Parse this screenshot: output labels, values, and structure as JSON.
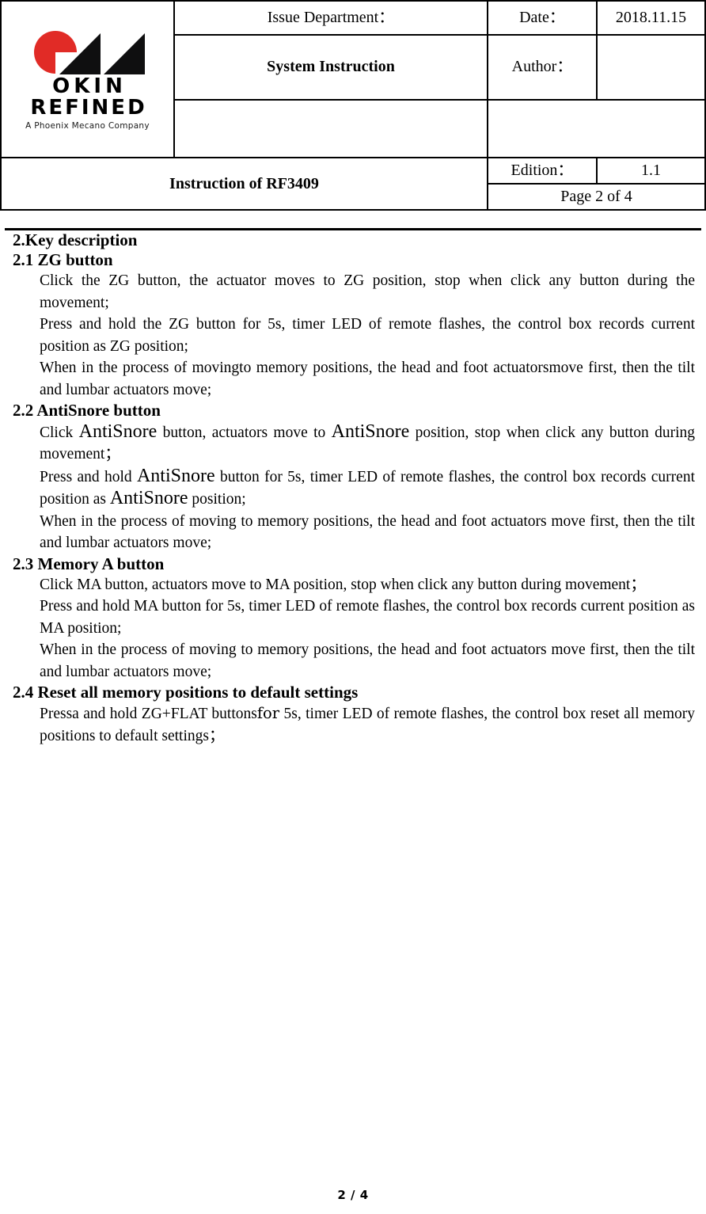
{
  "header": {
    "logo": {
      "brand_line1": "OKIN",
      "brand_line2": "REFINED",
      "tagline": "A Phoenix Mecano Company",
      "mark_red": "#E12B26",
      "mark_black": "#0F0F10"
    },
    "row1": {
      "issue_department_label": "Issue Department：",
      "date_label": "Date：",
      "date_value": "2018.11.15"
    },
    "row2": {
      "system_instruction": "System Instruction",
      "author_label": "Author：",
      "author_value": ""
    },
    "row3": {
      "blank_left": "",
      "blank_right": ""
    },
    "row4": {
      "doc_title": "Instruction of RF3409",
      "edition_label": "Edition：",
      "edition_value": "1.1"
    },
    "row5": {
      "page_text": "Page 2 of 4"
    }
  },
  "body": {
    "section_main": "2.Key description",
    "sections": [
      {
        "heading": "2.1 ZG    button",
        "paragraphs": [
          "Click the ZG button, the actuator moves to ZG position, stop when click any button during the movement;",
          "Press and hold the ZG button for 5s, timer LED of remote flashes, the control box records current position as ZG position;",
          "When in the process of movingto memory positions, the head and foot actuatorsmove first, then the tilt and lumbar actuators move;"
        ]
      },
      {
        "heading": "2.2   AntiSnore button",
        "paragraphs": [
          {
            "parts": [
              {
                "t": "Click ",
                "s": "normal"
              },
              {
                "t": "AntiSnore",
                "s": "big"
              },
              {
                "t": " button, actuators move to ",
                "s": "normal"
              },
              {
                "t": "AntiSnore",
                "s": "big"
              },
              {
                "t": " position, stop when click any button during movement；",
                "s": "normal"
              }
            ]
          },
          {
            "parts": [
              {
                "t": "Press and hold ",
                "s": "normal"
              },
              {
                "t": "AntiSnore",
                "s": "big"
              },
              {
                "t": " button for 5s, timer LED of remote flashes, the control box records current position as ",
                "s": "normal"
              },
              {
                "t": "AntiSnore",
                "s": "big"
              },
              {
                "t": " position;",
                "s": "normal"
              }
            ]
          },
          {
            "parts": [
              {
                "t": "When in the process of moving to memory positions, the head and foot actuators move first, then the tilt and lumbar actuators move;",
                "s": "normal"
              }
            ]
          }
        ]
      },
      {
        "heading": "2.3 Memory A button",
        "paragraphs": [
          "Click MA button, actuators move to MA position, stop when click any button during movement；",
          "Press and hold MA button for 5s, timer LED of remote flashes, the control box records current position as MA position;",
          "When in the process of moving to memory positions, the head and foot actuators move first, then the tilt and lumbar actuators move;"
        ]
      },
      {
        "heading": "2.4  Reset all memory positions to default settings",
        "paragraphs": [
          {
            "parts": [
              {
                "t": "Pressa and hold ZG+FLAT buttons",
                "s": "normal"
              },
              {
                "t": "for",
                "s": "alt"
              },
              {
                "t": " 5s, timer LED of remote flashes, the control box reset all memory positions to default settings；",
                "s": "normal"
              }
            ]
          }
        ]
      }
    ]
  },
  "footer": {
    "page_number": "2 / 4"
  }
}
